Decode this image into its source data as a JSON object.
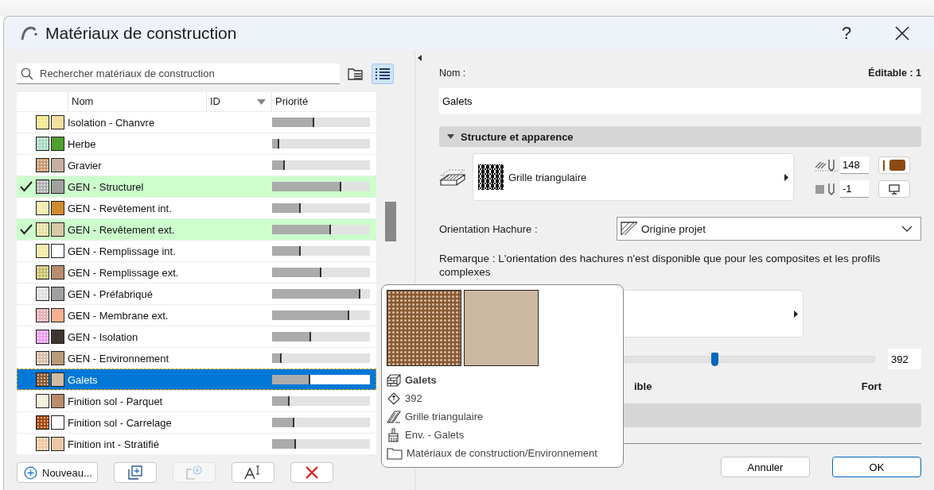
{
  "window": {
    "title": "Matériaux de construction",
    "help_label": "?"
  },
  "search": {
    "placeholder": "Rechercher matériaux de construction"
  },
  "view_toggle": [
    {
      "kind": "tree",
      "selected": false
    },
    {
      "kind": "list",
      "selected": true
    }
  ],
  "table": {
    "columns": [
      "Nom",
      "ID",
      "Priorité"
    ],
    "rows": [
      {
        "name": "Isolation - Chanvre",
        "checked": false,
        "selected": false,
        "swatches": [
          {
            "kind": "hatch",
            "color": "#f5e98a"
          },
          {
            "kind": "fill",
            "color": "#f5e0a0"
          }
        ],
        "level": 0.43
      },
      {
        "name": "Herbe",
        "checked": false,
        "selected": false,
        "swatches": [
          {
            "kind": "hatch",
            "color": "#a8dcc0"
          },
          {
            "kind": "fill",
            "color": "#50a030"
          }
        ],
        "level": 0.07
      },
      {
        "name": "Gravier",
        "checked": false,
        "selected": false,
        "swatches": [
          {
            "kind": "hatch",
            "color": "#c89a70"
          },
          {
            "kind": "fill",
            "color": "#c8b0a0"
          }
        ],
        "level": 0.13
      },
      {
        "name": "GEN - Structurel",
        "checked": true,
        "selected": false,
        "swatches": [
          {
            "kind": "hatch",
            "color": "#b0b0b0"
          },
          {
            "kind": "fill",
            "color": "#a0a0a0"
          }
        ],
        "level": 0.71
      },
      {
        "name": "GEN - Revêtement int.",
        "checked": false,
        "selected": false,
        "swatches": [
          {
            "kind": "hatch",
            "color": "#f3eaa8"
          },
          {
            "kind": "fill",
            "color": "#d08a30"
          }
        ],
        "level": 0.29
      },
      {
        "name": "GEN - Revêtement ext.",
        "checked": true,
        "selected": false,
        "swatches": [
          {
            "kind": "hatch",
            "color": "#e8dfa0"
          },
          {
            "kind": "fill",
            "color": "#d8c8a8"
          }
        ],
        "level": 0.6
      },
      {
        "name": "GEN - Remplissage int.",
        "checked": false,
        "selected": false,
        "swatches": [
          {
            "kind": "hatch",
            "color": "#f3e8a0"
          },
          {
            "kind": "fill",
            "color": "#ffffff"
          }
        ],
        "level": 0.29
      },
      {
        "name": "GEN - Remplissage ext.",
        "checked": false,
        "selected": false,
        "swatches": [
          {
            "kind": "hatch",
            "color": "#c8c070"
          },
          {
            "kind": "fill",
            "color": "#b88c6c"
          }
        ],
        "level": 0.5
      },
      {
        "name": "GEN - Préfabriqué",
        "checked": false,
        "selected": false,
        "swatches": [
          {
            "kind": "hatch",
            "color": "#e0e0e0"
          },
          {
            "kind": "fill",
            "color": "#a0a0a0"
          }
        ],
        "level": 0.9
      },
      {
        "name": "GEN - Membrane ext.",
        "checked": false,
        "selected": false,
        "swatches": [
          {
            "kind": "hatch",
            "color": "#e8b0b8"
          },
          {
            "kind": "fill",
            "color": "#f8b090"
          }
        ],
        "level": 0.79
      },
      {
        "name": "GEN - Isolation",
        "checked": false,
        "selected": false,
        "swatches": [
          {
            "kind": "hatch",
            "color": "#f0a0f0"
          },
          {
            "kind": "fill",
            "color": "#403430"
          }
        ],
        "level": 0.4
      },
      {
        "name": "GEN - Environnement",
        "checked": false,
        "selected": false,
        "swatches": [
          {
            "kind": "hatch",
            "color": "#d8c0a8"
          },
          {
            "kind": "fill",
            "color": "#b89c78"
          }
        ],
        "level": 0.1
      },
      {
        "name": "Galets",
        "checked": false,
        "selected": true,
        "swatches": [
          {
            "kind": "hatch",
            "color": "#8b5a30"
          },
          {
            "kind": "fill",
            "color": "#d0bca0"
          }
        ],
        "level": 0.39
      },
      {
        "name": "Finition sol - Parquet",
        "checked": false,
        "selected": false,
        "swatches": [
          {
            "kind": "hatch",
            "color": "#f2f0d8"
          },
          {
            "kind": "fill",
            "color": "#b88c6c"
          }
        ],
        "level": 0.18
      },
      {
        "name": "Finition sol - Carrelage",
        "checked": false,
        "selected": false,
        "swatches": [
          {
            "kind": "hatch",
            "color": "#a84810"
          },
          {
            "kind": "fill",
            "color": "#ffffff"
          }
        ],
        "level": 0.23
      },
      {
        "name": "Finition int - Stratifié",
        "checked": false,
        "selected": false,
        "swatches": [
          {
            "kind": "hatch",
            "color": "#f5c8a0"
          },
          {
            "kind": "fill",
            "color": "#e8c8a8"
          }
        ],
        "level": 0.24
      }
    ]
  },
  "bottom_buttons": [
    {
      "kind": "new",
      "label": "Nouveau...",
      "disabled": false
    },
    {
      "kind": "duplicate",
      "disabled": false
    },
    {
      "kind": "import",
      "disabled": true
    },
    {
      "kind": "rename",
      "disabled": false
    },
    {
      "kind": "delete",
      "disabled": false
    }
  ],
  "tooltip": {
    "swatches": [
      {
        "kind": "hatch",
        "color": "#8b5a30"
      },
      {
        "kind": "fill",
        "color": "#ccb8a0"
      }
    ],
    "lines": [
      {
        "kind": "material",
        "text": "Galets"
      },
      {
        "kind": "priority",
        "text": "392"
      },
      {
        "kind": "hatch",
        "text": "Grille triangulaire"
      },
      {
        "kind": "surface",
        "text": "Env. - Galets"
      },
      {
        "kind": "folder",
        "text": "Matériaux de construction/Environnement"
      }
    ]
  },
  "details": {
    "name_label": "Nom :",
    "editable": "Éditable : 1",
    "name_value": "Galets",
    "section": {
      "title": "Structure et apparence",
      "expanded": true
    },
    "hatch": {
      "name": "Grille triangulaire",
      "pen": "148",
      "pen_swatch": {
        "color": "#8b4a10"
      },
      "bg_pen": "-1"
    },
    "orientation": {
      "label": "Orientation Hachure :",
      "value": "Origine projet"
    },
    "remark": "Remarque : L'orientation des hachures n'est disponible que pour les composites et les profils complexes",
    "slider": {
      "level": 0.41,
      "value": "392",
      "low_label": "ible",
      "high_label": "Fort"
    }
  },
  "dialog_buttons": [
    {
      "label": "Annuler",
      "default": false
    },
    {
      "label": "OK",
      "default": true
    }
  ]
}
